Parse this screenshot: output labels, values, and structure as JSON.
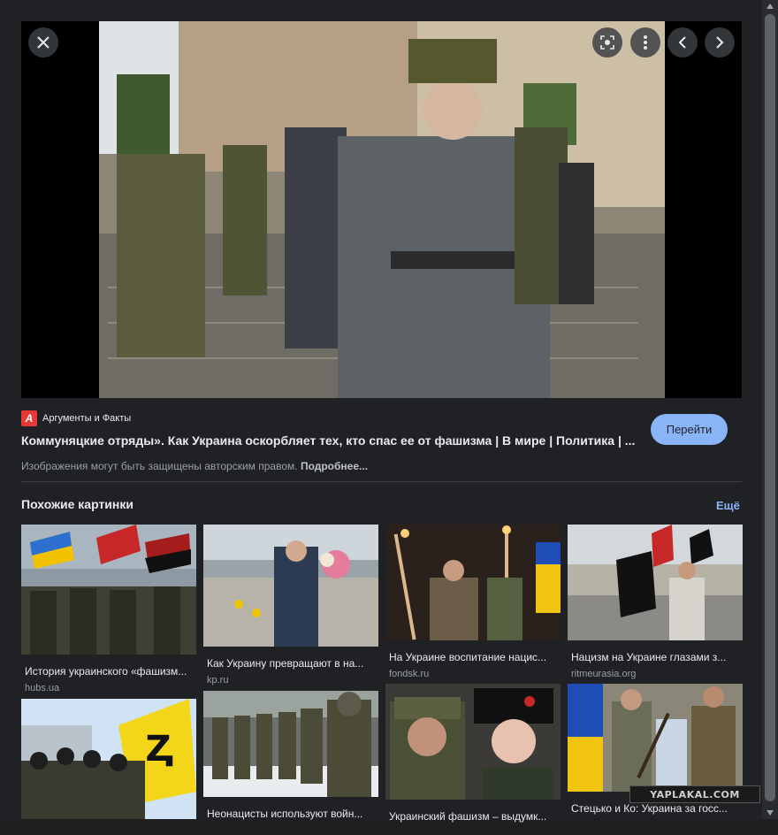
{
  "preview": {
    "source_name": "Аргументы и Факты",
    "source_logo_letter": "А",
    "title": "Коммуняцкие отряды». Как Украина оскорбляет тех, кто спас ее от фашизма | В мире | Политика | ...",
    "go_button": "Перейти",
    "copyright_text": "Изображения могут быть защищены авторским правом.",
    "copyright_more": "Подробнее..."
  },
  "similar": {
    "heading": "Похожие картинки",
    "more": "Ещё",
    "cards": [
      {
        "title": "История украинского «фашизм...",
        "source": "hubs.ua"
      },
      {
        "title": "Как Украину превращают в на...",
        "source": "kp.ru"
      },
      {
        "title": "На Украине воспитание нацис...",
        "source": "fondsk.ru"
      },
      {
        "title": "Нацизм на Украине глазами з...",
        "source": "ritmeurasia.org"
      },
      {
        "title": "",
        "source": ""
      },
      {
        "title": "Неонацисты используют войн...",
        "source": ""
      },
      {
        "title": "Украинский фашизм – выдумк...",
        "source": ""
      },
      {
        "title": "Стецько и Ко: Украина за госс...",
        "source": ""
      }
    ]
  },
  "watermark": "YAPLAKAL.COM",
  "icons": [
    "close-icon",
    "lens-icon",
    "more-vert-icon",
    "chevron-left-icon",
    "chevron-right-icon"
  ],
  "colors": {
    "accent": "#8ab4f8",
    "background": "#202124",
    "source_logo": "#e53935"
  }
}
